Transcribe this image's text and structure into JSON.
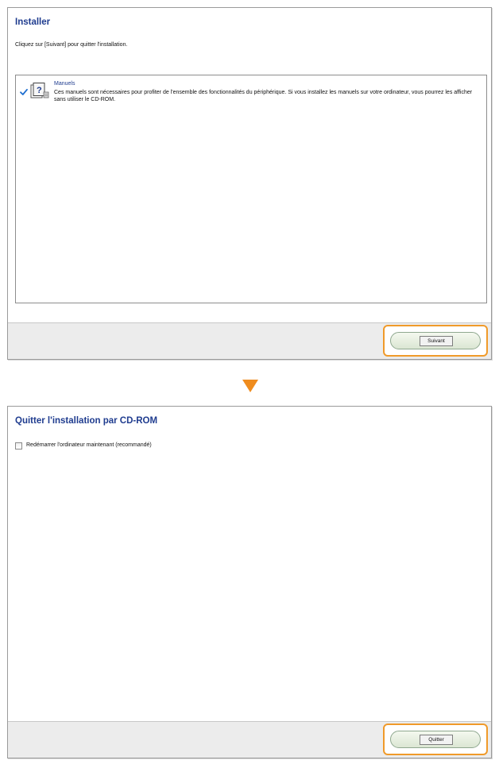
{
  "dialog1": {
    "title": "Installer",
    "instruction": "Cliquez sur [Suivant] pour quitter l'installation.",
    "items": [
      {
        "name": "Manuels",
        "description": "Ces manuels sont nécessaires pour profiter de l'ensemble des fonctionnalités du périphérique. Si vous installez les manuels sur votre ordinateur, vous pourrez les afficher sans utiliser le CD-ROM.",
        "checked": true
      }
    ],
    "next_label": "Suivant"
  },
  "dialog2": {
    "title": "Quitter l'installation par CD-ROM",
    "restart_label": "Redémarrer l'ordinateur maintenant (recommandé)",
    "restart_checked": false,
    "quit_label": "Quitter"
  },
  "colors": {
    "title": "#1f3c8f",
    "highlight": "#f09a2a",
    "arrow": "#ef8c1e",
    "check": "#1f6fd0"
  },
  "icons": {
    "check": "checkmark-icon",
    "manual": "help-book-icon",
    "arrow": "arrow-down-icon"
  }
}
